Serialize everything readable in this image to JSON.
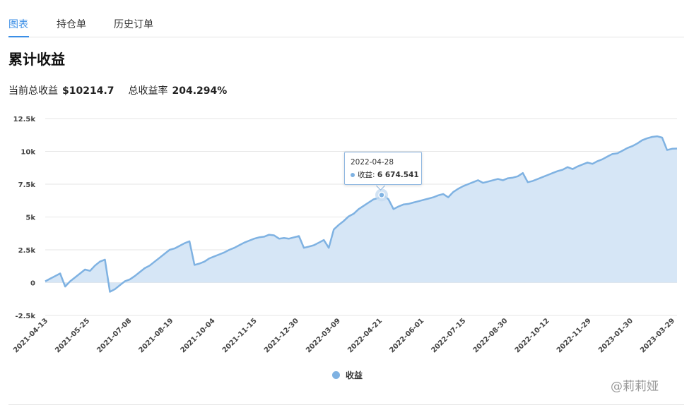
{
  "tabs": [
    {
      "label": "图表"
    },
    {
      "label": "持仓单"
    },
    {
      "label": "历史订单"
    }
  ],
  "title": "累计收益",
  "summary": {
    "profit_label": "当前总收益",
    "profit_value": "$10214.7",
    "rate_label": "总收益率",
    "rate_value": "204.294%"
  },
  "tooltip": {
    "date": "2022-04-28",
    "label": "收益:",
    "value": "6 674.541"
  },
  "watermark": "@莉莉娅",
  "colors": {
    "accent": "#3a8ee6",
    "series_line": "#7fb2e2",
    "series_fill": "#d6e6f6"
  },
  "chart_data": {
    "type": "area",
    "yticks": [
      "12.5k",
      "10k",
      "7.5k",
      "5k",
      "2.5k",
      "0",
      "-2.5k"
    ],
    "ylim": [
      -2500,
      12500
    ],
    "xticks": [
      "2021-04-13",
      "2021-05-25",
      "2021-07-08",
      "2021-08-19",
      "2021-10-04",
      "2021-11-15",
      "2021-12-30",
      "2022-03-09",
      "2022-04-21",
      "2022-06-01",
      "2022-07-15",
      "2022-08-30",
      "2022-10-12",
      "2022-11-29",
      "2023-01-30",
      "2023-03-29"
    ],
    "grid": true,
    "legend": "bottom",
    "series": [
      {
        "name": "收益",
        "values": [
          100,
          300,
          500,
          700,
          -300,
          100,
          400,
          700,
          1000,
          900,
          1300,
          1600,
          1750,
          -700,
          -500,
          -200,
          100,
          250,
          500,
          800,
          1100,
          1300,
          1600,
          1900,
          2200,
          2500,
          2600,
          2800,
          3000,
          3150,
          1350,
          1450,
          1600,
          1850,
          2000,
          2150,
          2300,
          2500,
          2650,
          2850,
          3050,
          3200,
          3350,
          3450,
          3500,
          3650,
          3600,
          3350,
          3400,
          3350,
          3450,
          3550,
          2650,
          2750,
          2850,
          3050,
          3250,
          2650,
          4050,
          4400,
          4700,
          5050,
          5250,
          5600,
          5850,
          6100,
          6350,
          6450,
          6650,
          6350,
          5600,
          5800,
          5950,
          6000,
          6100,
          6200,
          6300,
          6400,
          6500,
          6650,
          6750,
          6500,
          6900,
          7150,
          7350,
          7500,
          7650,
          7800,
          7600,
          7700,
          7800,
          7900,
          7800,
          7950,
          8000,
          8100,
          8350,
          7650,
          7750,
          7900,
          8050,
          8200,
          8350,
          8500,
          8600,
          8800,
          8650,
          8850,
          9000,
          9150,
          9050,
          9250,
          9400,
          9600,
          9800,
          9850,
          10050,
          10250,
          10400,
          10600,
          10850,
          11000,
          11100,
          11150,
          11050,
          10100,
          10200,
          10214.7
        ]
      }
    ],
    "highlight": {
      "x": "2022-04-28",
      "y": 6674.541
    }
  }
}
